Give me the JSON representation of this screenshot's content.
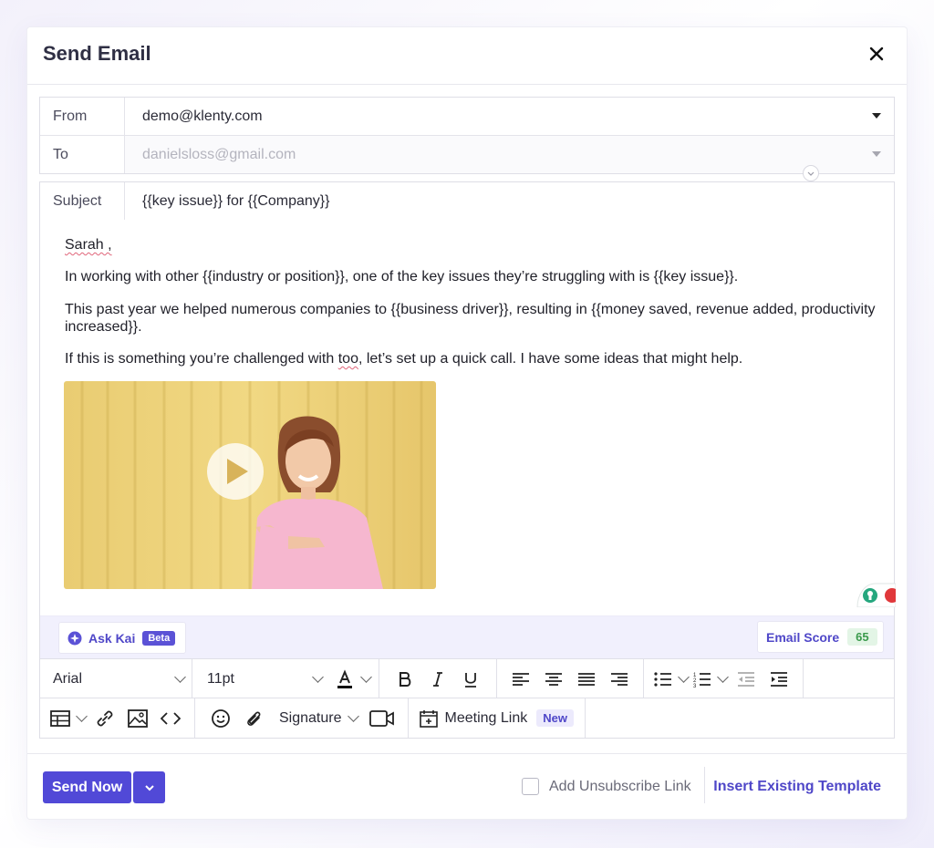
{
  "modal": {
    "title": "Send Email"
  },
  "from": {
    "label": "From",
    "value": "demo@klenty.com"
  },
  "to": {
    "label": "To",
    "value": "danielsloss@gmail.com"
  },
  "subject": {
    "label": "Subject",
    "value": "{{key issue}} for {{Company}}"
  },
  "body": {
    "greeting": "Sarah ,",
    "p1": "In working with other {{industry or position}}, one of the key issues they’re struggling with is {{key issue}}.",
    "p2_line1": "This past year we helped numerous companies to {{business driver}}, resulting in {{money saved, revenue added, productivity",
    "p2_line2": "increased}}.",
    "p3_before": "If this is something you’re challenged with ",
    "p3_underlined": "too",
    "p3_after": ", let’s set up a quick call. I have some ideas that might help."
  },
  "kai": {
    "label": "Ask Kai",
    "badge": "Beta"
  },
  "score": {
    "label": "Email Score",
    "value": "65"
  },
  "toolbar": {
    "font": "Arial",
    "size": "11pt",
    "signature": "Signature",
    "meeting_link": "Meeting Link",
    "meeting_badge": "New"
  },
  "footer": {
    "send_label": "Send Now",
    "unsubscribe_label": "Add Unsubscribe Link",
    "insert_template": "Insert Existing Template"
  },
  "colors": {
    "accent": "#5149d7",
    "score_green": "#3a9a4c"
  }
}
